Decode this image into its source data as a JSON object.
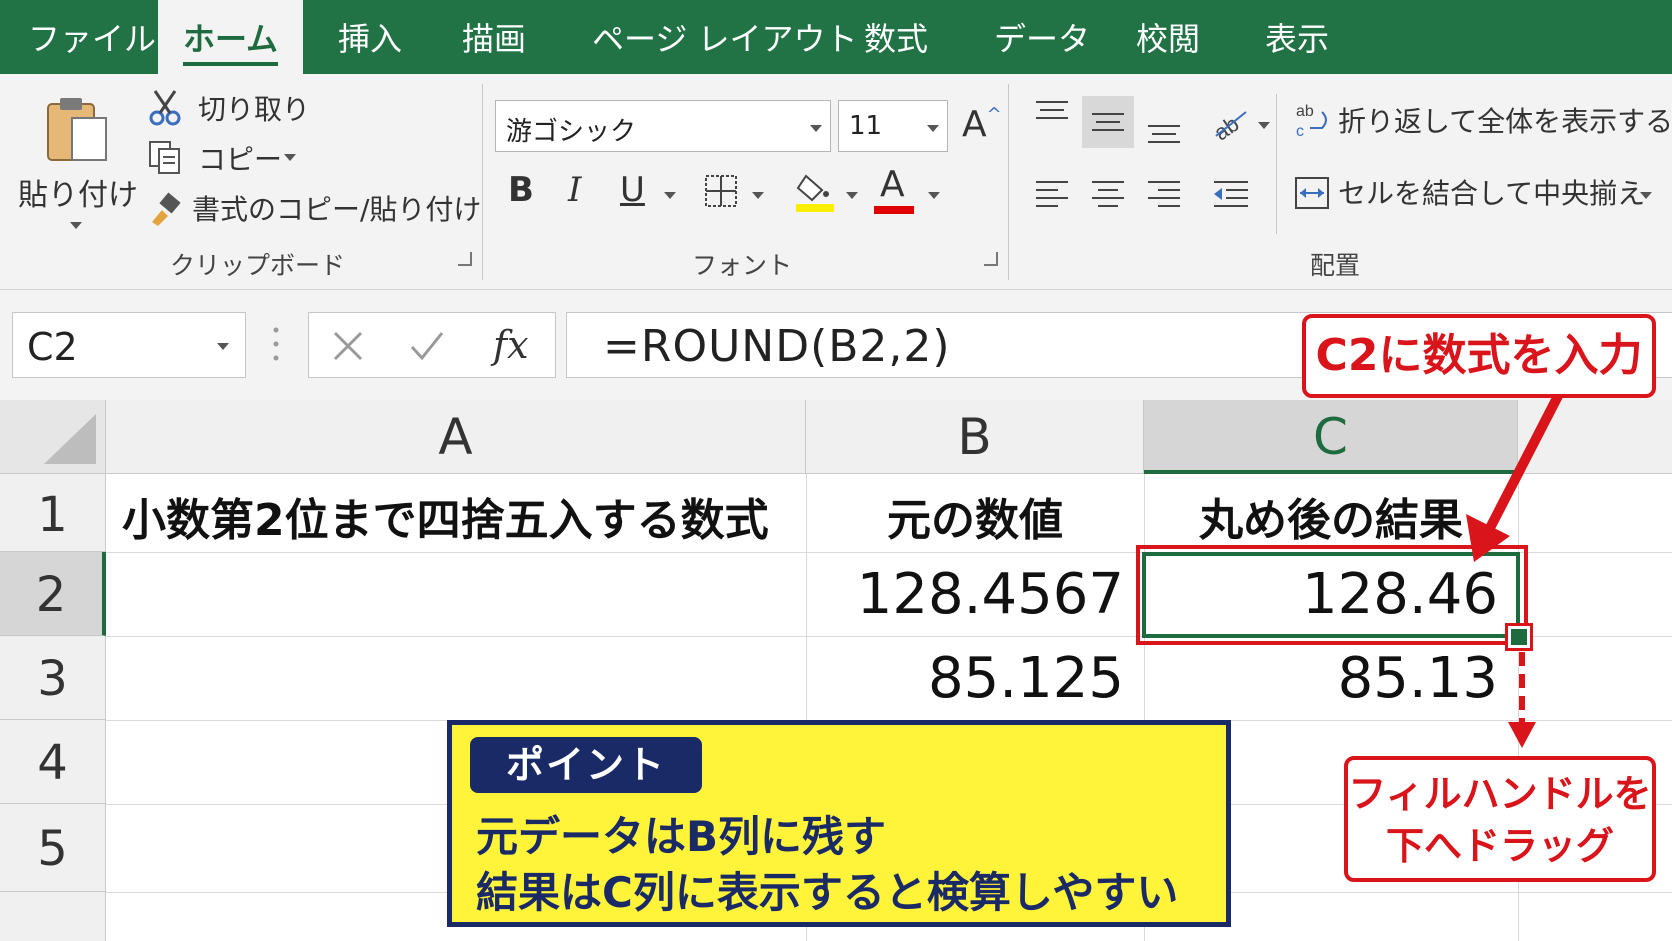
{
  "ribbon": {
    "tabs": [
      "ファイル",
      "ホーム",
      "挿入",
      "描画",
      "ページ レイアウト",
      "数式",
      "データ",
      "校閲",
      "表示"
    ],
    "clipboard": {
      "paste": "貼り付け",
      "cut": "切り取り",
      "copy": "コピー",
      "format_painter": "書式のコピー/貼り付け",
      "group": "クリップボード"
    },
    "font": {
      "name": "游ゴシック",
      "size": "11",
      "bold": "B",
      "italic": "I",
      "underline": "U",
      "font_color_letter": "A",
      "grow_letter": "A",
      "group": "フォント",
      "highlight_color": "#ffee00",
      "font_color": "#e00000"
    },
    "alignment": {
      "wrap_text": "折り返して全体を表示する",
      "merge_center": "セルを結合して中央揃え",
      "group": "配置"
    }
  },
  "formula_bar": {
    "name_box": "C2",
    "fx": "fx",
    "formula": "=ROUND(B2,2)"
  },
  "sheet": {
    "columns": [
      "A",
      "B",
      "C"
    ],
    "rows": [
      "1",
      "2",
      "3",
      "4",
      "5"
    ],
    "cells": {
      "A1": "小数第2位まで四捨五入する数式",
      "B1": "元の数値",
      "C1": "丸め後の結果",
      "B2": "128.4567",
      "C2": "128.46",
      "B3": "85.125",
      "C3": "85.13"
    },
    "selected_cell": "C2"
  },
  "annotations": {
    "input_callout": "C2に数式を入力",
    "fill_callout_line1": "フィルハンドルを",
    "fill_callout_line2": "下へドラッグ",
    "point_tag": "ポイント",
    "point_line1": "元データはB列に残す",
    "point_line2": "結果はC列に表示すると検算しやすい"
  },
  "colors": {
    "excel_green": "#217346",
    "selection_green": "#1e6b3f",
    "annotation_red": "#d9141b",
    "point_yellow": "#fff43a",
    "point_navy": "#1a2a66"
  }
}
